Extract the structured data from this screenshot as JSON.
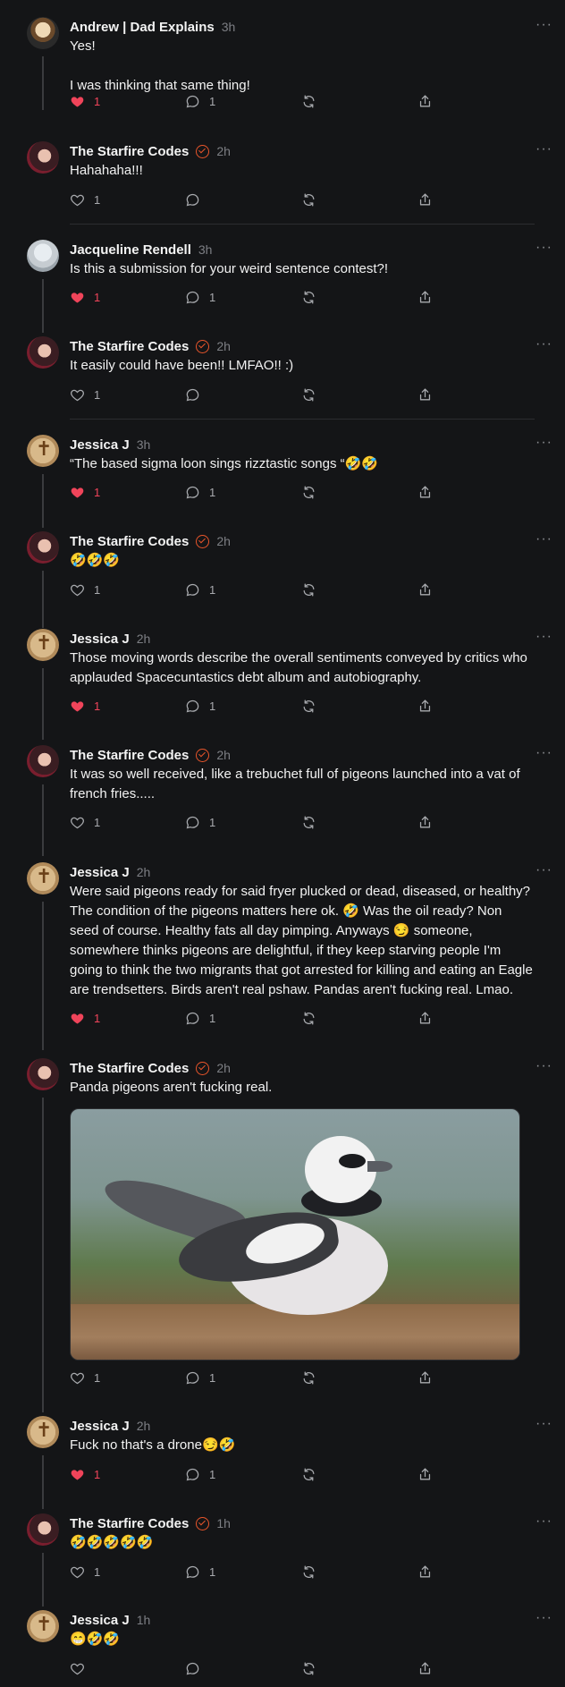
{
  "colors": {
    "background": "#141517",
    "like_red": "#f0445a",
    "verified_orange": "#e8552b",
    "muted": "#7d7f84"
  },
  "icons": {
    "like": "heart-icon",
    "reply": "comment-icon",
    "repost": "repost-icon",
    "share": "share-icon",
    "more": "more-icon"
  },
  "posts": [
    {
      "author": "Andrew | Dad Explains",
      "time": "3h",
      "text": "Yes!\n\nI was thinking that same thing!",
      "likes": "1",
      "liked": true,
      "replies": "1",
      "verified": false
    },
    {
      "author": "The Starfire Codes",
      "time": "2h",
      "text": "Hahahaha!!!",
      "likes": "1",
      "liked": false,
      "replies": "",
      "verified": true
    },
    {
      "author": "Jacqueline Rendell",
      "time": "3h",
      "text": "Is this a submission for your weird sentence contest?!",
      "likes": "1",
      "liked": true,
      "replies": "1",
      "verified": false
    },
    {
      "author": "The Starfire Codes",
      "time": "2h",
      "text": "It easily could have been!! LMFAO!! :)",
      "likes": "1",
      "liked": false,
      "replies": "",
      "verified": true
    },
    {
      "author": "Jessica J",
      "time": "3h",
      "text": "“The based sigma loon sings rizztastic songs “🤣🤣",
      "likes": "1",
      "liked": true,
      "replies": "1",
      "verified": false
    },
    {
      "author": "The Starfire Codes",
      "time": "2h",
      "text": "🤣🤣🤣",
      "likes": "1",
      "liked": false,
      "replies": "1",
      "verified": true
    },
    {
      "author": "Jessica J",
      "time": "2h",
      "text": "Those moving words describe the overall sentiments conveyed by critics who applauded Spacecuntastics debt album and autobiography.",
      "likes": "1",
      "liked": true,
      "replies": "1",
      "verified": false
    },
    {
      "author": "The Starfire Codes",
      "time": "2h",
      "text": "It was so well received, like a trebuchet full of pigeons launched into a vat of french fries.....",
      "likes": "1",
      "liked": false,
      "replies": "1",
      "verified": true
    },
    {
      "author": "Jessica J",
      "time": "2h",
      "text": "Were said pigeons ready for said fryer plucked or dead, diseased, or healthy? The condition of the pigeons matters here ok. 🤣 Was the oil ready? Non seed of course. Healthy fats all day pimping. Anyways 😏 someone, somewhere thinks pigeons are delightful, if they keep starving people I'm going to think the two migrants that got arrested for killing and eating an Eagle are trendsetters. Birds aren't real pshaw. Pandas aren't fucking real. Lmao.",
      "likes": "1",
      "liked": true,
      "replies": "1",
      "verified": false
    },
    {
      "author": "The Starfire Codes",
      "time": "2h",
      "text": "Panda pigeons aren't fucking real.",
      "likes": "1",
      "liked": false,
      "replies": "1",
      "verified": true
    },
    {
      "author": "Jessica J",
      "time": "2h",
      "text": "Fuck no that's a drone😏🤣",
      "likes": "1",
      "liked": true,
      "replies": "1",
      "verified": false
    },
    {
      "author": "The Starfire Codes",
      "time": "1h",
      "text": "🤣🤣🤣🤣🤣",
      "likes": "1",
      "liked": false,
      "replies": "1",
      "verified": true
    },
    {
      "author": "Jessica J",
      "time": "1h",
      "text": "😁🤣🤣",
      "likes": "",
      "liked": false,
      "replies": "",
      "verified": false
    }
  ]
}
